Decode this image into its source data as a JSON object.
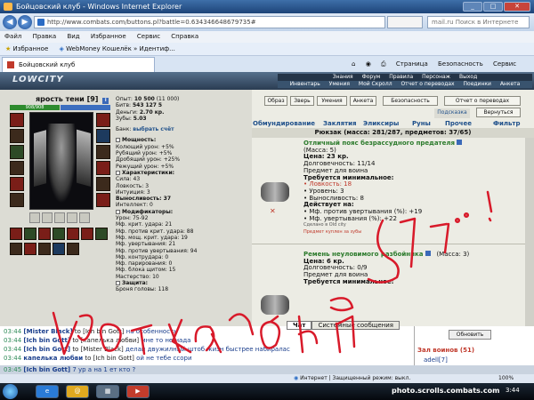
{
  "window": {
    "title": "Бойцовский клуб - Windows Internet Explorer"
  },
  "browser": {
    "url": "http://www.combats.com/buttons.pl?battle=0.634346648679735#",
    "search_placeholder": "mail.ru Поиск в Интернете",
    "menu": [
      "Файл",
      "Правка",
      "Вид",
      "Избранное",
      "Сервис",
      "Справка"
    ],
    "favorites_label": "Избранное",
    "fav_link": "WebMoney Кошелёк » Идентиф...",
    "tab_title": "Бойцовский клуб",
    "tools": [
      "Страница",
      "Безопасность",
      "Сервис"
    ]
  },
  "game": {
    "logo": "LOWCITY",
    "nav_row1": [
      "Знания",
      "Форум",
      "Правила",
      "Персонаж",
      "Выход"
    ],
    "nav_row2": [
      "Инвентарь",
      "Умения",
      "Мой Скролл",
      "Отчет о переводах",
      "Поединки",
      "Анкета"
    ],
    "character": {
      "name": "ярость тени",
      "level": "[9]",
      "hp": "908/908"
    },
    "stats": {
      "exp_label": "Опыт:",
      "exp": "10 500",
      "exp_next": "(11 000)",
      "wins_label": "Битв:",
      "wins": "543",
      "wins_b": "127",
      "wins_c": "5",
      "money_label": "Деньги:",
      "money": "2.70 кр.",
      "teeth_label": "Зубы:",
      "teeth": "5.03",
      "bank_label": "Банк:",
      "bank_link": "выбрать счёт",
      "power_header": "Мощность:",
      "power": [
        "Колющий урон: +5%",
        "Рубящий урон: +5%",
        "Дробящий урон: +25%",
        "Режущий урон: +5%"
      ],
      "char_header": "Характеристики:",
      "chars": [
        "Сила: 43",
        "Ловкость: 3",
        "Интуиция: 3",
        "Выносливость: 37",
        "Интеллект: 0"
      ],
      "mod_header": "Модификаторы:",
      "mods": [
        "Урон: 75-92",
        "Мф. крит. удара: 21",
        "Мф. против крит. удара: 88",
        "Мф. мощ. крит. удара: 19",
        "Мф. увертывания: 21",
        "Мф. против увертывания: 94",
        "Мф. контрудара: 0",
        "Мф. парирования: 0",
        "Мф. блока щитом: 15",
        "Мастерство: 10"
      ],
      "def_header": "Защита:",
      "def_value": "Броня головы: 118"
    },
    "buttons": [
      "Образ",
      "Зверь",
      "Умения",
      "Анкета",
      "Безопасность",
      "Отчет о переводах",
      "Подсказка",
      "Вернуться"
    ],
    "inv_tabs": [
      "Обмундирование",
      "Заклятия",
      "Эликсиры",
      "Руны",
      "Прочее",
      "Фильтр"
    ],
    "backpack": "Рюкзак (масса: 281/287, предметов: 37/65)",
    "items": [
      {
        "name": "Отличный пояс безрассудного предателя",
        "mass": "(Масса: 5)",
        "price": "Цена: 23 кр.",
        "durability": "Долговечность: 11/14",
        "for": "Предмет для воина",
        "req_header": "Требуется минимальное:",
        "reqs": [
          "• Ловкость: 18",
          "• Уровень: 3",
          "• Выносливость: 8"
        ],
        "acts_header": "Действует на:",
        "acts": [
          "• Мф. против увертывания (%): +19",
          "• Мф. увертывания (%): +22"
        ],
        "made": "Сделано в Old city",
        "sold": "Предмет куплен за зубы"
      },
      {
        "name": "Ремень неуловимого разбойника",
        "mass": "(Масса: 3)",
        "price": "Цена: 6 кр.",
        "durability": "Долговечность: 0/9",
        "for": "Предмет для воина",
        "req_header": "Требуется минимальное:"
      }
    ]
  },
  "chat": {
    "tabs": [
      "Чат",
      "Системные сообщения"
    ],
    "lines": [
      {
        "time": "03:44",
        "from": "[Mister Black]",
        "to": "to [Ich bin Gott]",
        "text": "на особенность"
      },
      {
        "time": "03:44",
        "from": "[Ich bin Gott]",
        "to": "to [капелька любви]",
        "text": "мне то не нада"
      },
      {
        "time": "03:44",
        "from": "[Ich bin Gott]",
        "to": "to [Mister Black]",
        "text": "делай двужилный штоб жизн быстрее набиралас"
      },
      {
        "time": "03:44",
        "from": "капелька любви",
        "to": "to [Ich bin Gott]",
        "text": "ой не тебе ссори"
      },
      {
        "time": "03:45",
        "from": "[Ich bin Gott]",
        "to": "",
        "text": "7 ур а на 1 ет кто ?"
      }
    ],
    "refresh_button": "Обновить",
    "warriors": "Зал воинов (51)",
    "online_first": "adell[7]"
  },
  "status": {
    "zone": "Интернет | Защищенный режим: выкл.",
    "zoom": "100%"
  },
  "taskbar": {
    "time": "3:44"
  },
  "overlay": {
    "scrawl": "Вот так 2 на 5]...!",
    "watermark": "photo.scrolls.combats.com"
  }
}
